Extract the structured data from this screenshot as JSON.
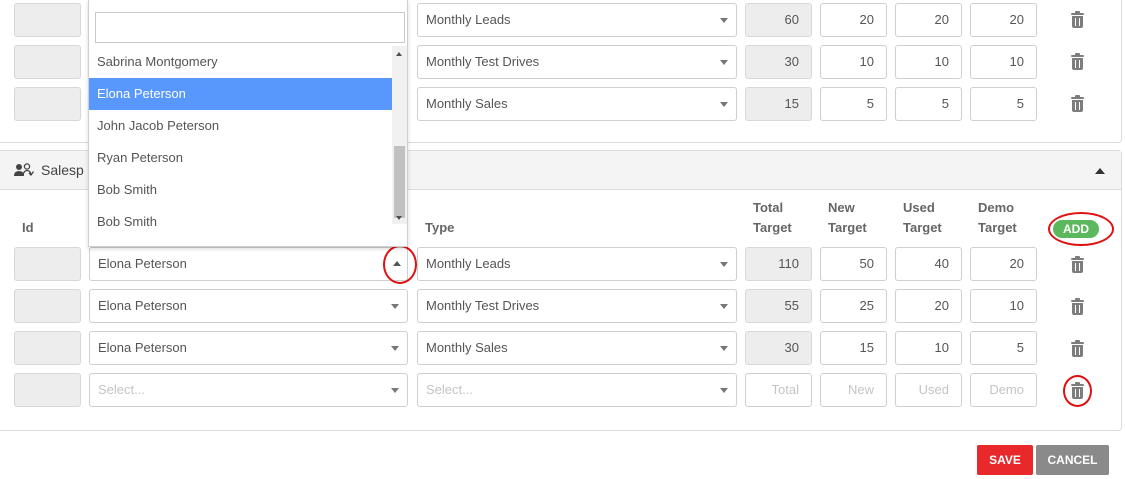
{
  "top_rows": [
    {
      "type": "Monthly Leads",
      "total": "60",
      "new": "20",
      "used": "20",
      "demo": "20"
    },
    {
      "type": "Monthly Test Drives",
      "total": "30",
      "new": "10",
      "used": "10",
      "demo": "10"
    },
    {
      "type": "Monthly Sales",
      "total": "15",
      "new": "5",
      "used": "5",
      "demo": "5"
    }
  ],
  "dropdown": {
    "search_value": "",
    "options": [
      "Sabrina Montgomery",
      "Elona Peterson",
      "John Jacob Peterson",
      "Ryan Peterson",
      "Bob Smith",
      "Bob Smith"
    ],
    "highlighted": "Elona Peterson"
  },
  "section": {
    "title": "Salesp",
    "headers": {
      "id": "Id",
      "type": "Type",
      "total_1": "Total",
      "total_2": "Target",
      "new_1": "New",
      "new_2": "Target",
      "used_1": "Used",
      "used_2": "Target",
      "demo_1": "Demo",
      "demo_2": "Target"
    },
    "add_label": "ADD",
    "rows": [
      {
        "salesperson": "Elona Peterson",
        "type": "Monthly Leads",
        "total": "110",
        "new": "50",
        "used": "40",
        "demo": "20"
      },
      {
        "salesperson": "Elona Peterson",
        "type": "Monthly Test Drives",
        "total": "55",
        "new": "25",
        "used": "20",
        "demo": "10"
      },
      {
        "salesperson": "Elona Peterson",
        "type": "Monthly Sales",
        "total": "30",
        "new": "15",
        "used": "10",
        "demo": "5"
      }
    ],
    "new_row": {
      "salesperson_placeholder": "Select...",
      "type_placeholder": "Select...",
      "total_placeholder": "Total",
      "new_placeholder": "New",
      "used_placeholder": "Used",
      "demo_placeholder": "Demo"
    }
  },
  "footer": {
    "save_label": "SAVE",
    "cancel_label": "CANCEL"
  },
  "colors": {
    "highlight": "#5897fb",
    "add": "#5cb85c",
    "save": "#e8282a",
    "cancel": "#8a8a8a",
    "annotation": "#e01010"
  }
}
